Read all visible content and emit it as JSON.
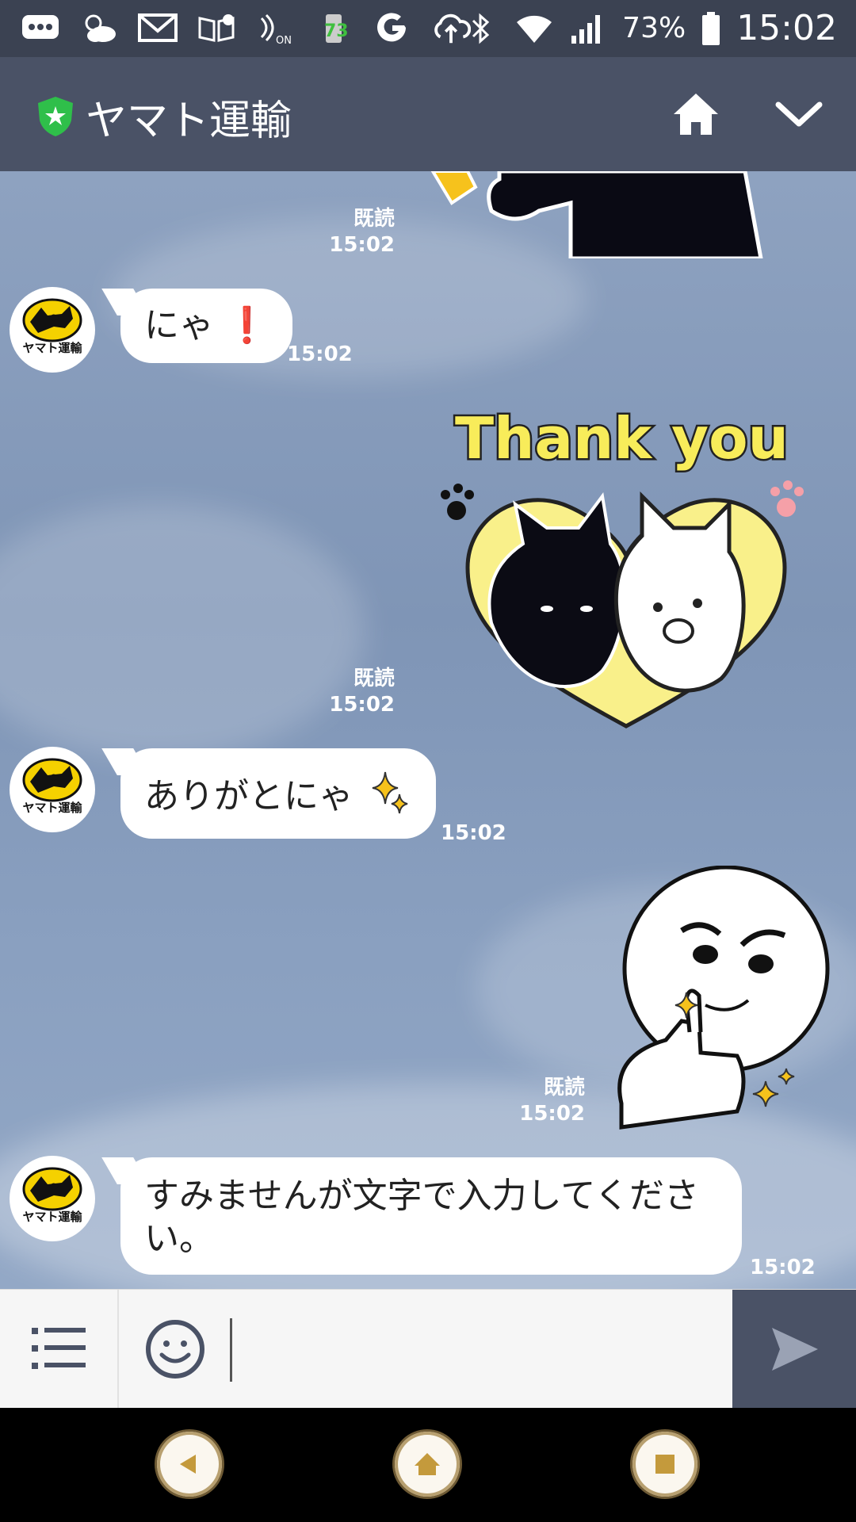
{
  "status_bar": {
    "battery_percent": "73%",
    "time": "15:02",
    "notification_badge": "73",
    "icons": [
      "messages-icon",
      "weather-icon",
      "gmail-icon",
      "reader-icon",
      "nfc-icon",
      "battery-mix-icon",
      "google-icon",
      "cloud-upload-icon",
      "bluetooth-icon",
      "wifi-icon",
      "signal-icon",
      "battery-icon"
    ]
  },
  "header": {
    "title": "ヤマト運輸",
    "icons": [
      "verified-shield-icon",
      "home-icon",
      "chevron-down-icon"
    ]
  },
  "avatar_label": "ヤマト運輸",
  "messages": [
    {
      "type": "sticker",
      "side": "right",
      "sticker": "character-arm-sticker-cropped",
      "read": "既読",
      "time": "15:02"
    },
    {
      "type": "text",
      "side": "left",
      "text": "にゃ",
      "emoji": "❗",
      "time": "15:02"
    },
    {
      "type": "sticker",
      "side": "right",
      "sticker": "thank-you-cats-sticker",
      "sticker_text": "Thank you",
      "read": "既読",
      "time": "15:02"
    },
    {
      "type": "text",
      "side": "left",
      "text": "ありがとにゃ",
      "emoji": "sparkles-icon",
      "time": "15:02"
    },
    {
      "type": "sticker",
      "side": "right",
      "sticker": "thumbs-up-moon-sticker",
      "read": "既読",
      "time": "15:02"
    },
    {
      "type": "text",
      "side": "left",
      "text": "すみませんが文字で入力してください。",
      "time": "15:02"
    }
  ],
  "input_bar": {
    "icons": [
      "menu-list-icon",
      "emoji-icon",
      "send-icon"
    ],
    "value": ""
  },
  "nav_bar": {
    "icons": [
      "back-icon",
      "home-icon",
      "recents-icon"
    ]
  },
  "colors": {
    "status_bar": "#3b4252",
    "header": "#4a5266",
    "chat_background": "#8ea2c0",
    "bubble": "#ffffff",
    "verified_green": "#2fbf4a",
    "yamato_yellow": "#f5d100"
  }
}
